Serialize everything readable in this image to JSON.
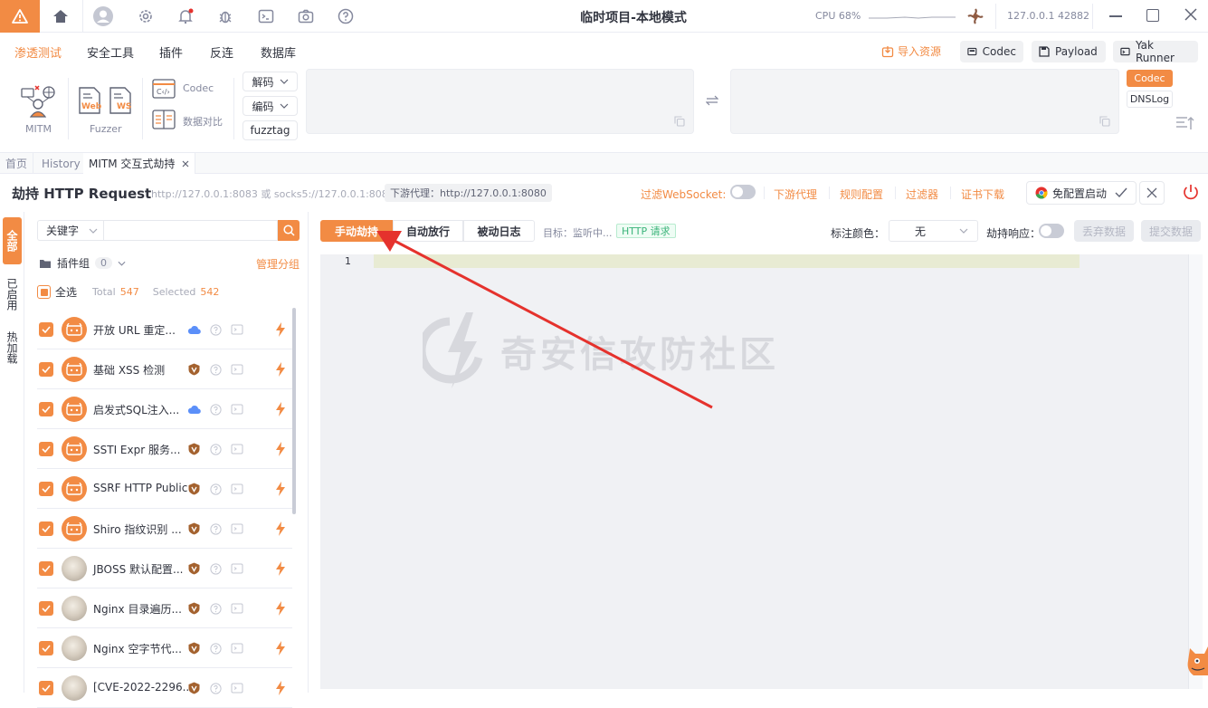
{
  "titlebar": {
    "title": "临时项目-本地模式",
    "cpu_label": "CPU 68%",
    "address": "127.0.0.1 42882"
  },
  "menubar": {
    "items": [
      "渗透测试",
      "安全工具",
      "插件",
      "反连",
      "数据库"
    ],
    "active_index": 0,
    "import_label": "导入资源",
    "right_buttons": [
      "Codec",
      "Payload",
      "Yak Runner"
    ]
  },
  "toolbox": {
    "mitm": "MITM",
    "fuzzer": "Fuzzer",
    "web": "Web",
    "ws": "WS",
    "codec": "Codec",
    "compare": "数据对比",
    "decode": "解码",
    "encode": "编码",
    "fuzztag": "fuzztag",
    "side_codec": "Codec",
    "side_dnslog": "DNSLog"
  },
  "tabs": {
    "home": "首页",
    "history": "History",
    "mitm": "MITM 交互式劫持"
  },
  "header": {
    "title": "劫持 HTTP Request",
    "proxy_addr": "http://127.0.0.1:8083 或 socks5://127.0.0.1:8083",
    "downstream_badge": "下游代理：http://127.0.0.1:8080",
    "filter_ws": "过滤WebSocket:",
    "downstream": "下游代理",
    "rules": "规则配置",
    "filter": "过滤器",
    "cert": "证书下载",
    "chrome": "免配置启动"
  },
  "sidebar": {
    "vtabs": [
      "全部",
      "已启用",
      "热加载"
    ],
    "search_type": "关键字",
    "search_placeholder": "",
    "group_label": "插件组",
    "group_count": "0",
    "manage_group": "管理分组",
    "select_all": "全选",
    "total_label": "Total",
    "total": "547",
    "selected_label": "Selected",
    "selected": "542",
    "plugins": [
      {
        "name": "开放 URL 重定...",
        "type": "cloud-icon",
        "avatar": "orange"
      },
      {
        "name": "基础 XSS 检测",
        "type": "shield-icon",
        "avatar": "orange"
      },
      {
        "name": "启发式SQL注入...",
        "type": "cloud-icon",
        "avatar": "orange"
      },
      {
        "name": "SSTI Expr 服务...",
        "type": "shield-icon",
        "avatar": "orange"
      },
      {
        "name": "SSRF HTTP Public",
        "type": "shield-icon",
        "avatar": "orange"
      },
      {
        "name": "Shiro 指纹识别 ...",
        "type": "shield-icon",
        "avatar": "orange"
      },
      {
        "name": "JBOSS 默认配置...",
        "type": "shield-icon",
        "avatar": "photo"
      },
      {
        "name": "Nginx 目录遍历...",
        "type": "shield-icon",
        "avatar": "photo"
      },
      {
        "name": "Nginx 空字节代...",
        "type": "shield-icon",
        "avatar": "photo"
      },
      {
        "name": "[CVE-2022-2296...",
        "type": "shield-icon",
        "avatar": "photo"
      }
    ]
  },
  "main": {
    "seg_manual": "手动劫持",
    "seg_auto": "自动放行",
    "seg_passive": "被动日志",
    "target_label": "目标：监听中...",
    "http_badge": "HTTP 请求",
    "color_label": "标注颜色：",
    "color_value": "无",
    "hijack_resp": "劫持响应：",
    "discard": "丢弃数据",
    "submit": "提交数据",
    "line_no": "1",
    "watermark": "奇安信攻防社区"
  },
  "colors": {
    "accent": "#f28b44",
    "arrow": "#e5322d"
  }
}
